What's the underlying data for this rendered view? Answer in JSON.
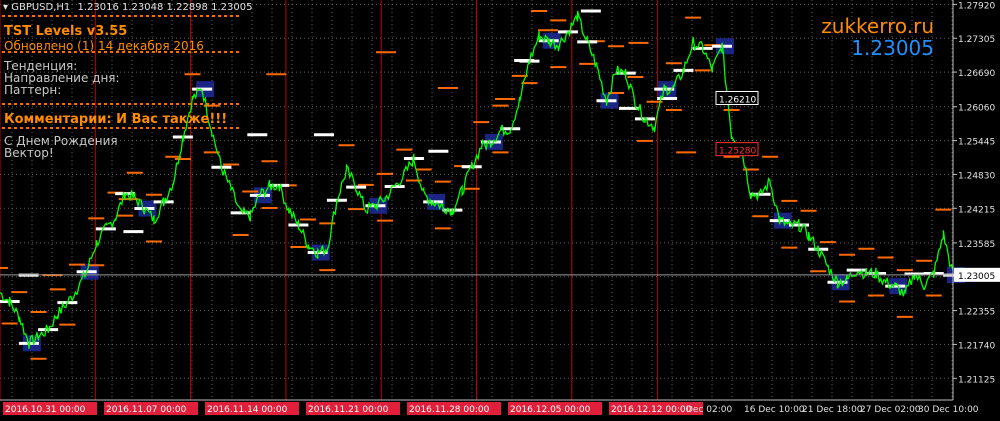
{
  "header": {
    "symbol": "GBPUSD,H1",
    "ohlc": "1.23016 1.23048 1.22898 1.23005"
  },
  "indicator": {
    "title": "TST Levels v3.55",
    "updated": "Обновлено (1)  14 декабря 2016",
    "trend_label": "Тенденция:",
    "direction_label": "Направление дня:",
    "pattern_label": "Паттерн:",
    "comment": "Комментарии: И Вас также!!!",
    "greeting_line1": "С Днем Рождения",
    "greeting_line2": "Вектор!"
  },
  "brand": {
    "site": "zukkerro.ru",
    "price": "1.23005"
  },
  "colors": {
    "background": "#000000",
    "grid": "#7a7a7a",
    "price_line": "#00ff00",
    "resistance": "#ff6a00",
    "level_white": "#ffffff",
    "zone": "#1e2a9a",
    "separator": "#c00000",
    "orange_text": "#ff8c00",
    "blue_text": "#1e90ff",
    "date_box": "#e0203a"
  },
  "chart_data": {
    "type": "line",
    "title": "GBPUSD,H1",
    "ylim": [
      1.2073,
      1.28
    ],
    "y_ticks": [
      "1.27920",
      "1.27305",
      "1.26690",
      "1.26060",
      "1.25445",
      "1.24830",
      "1.24215",
      "1.23585",
      "1.22970",
      "1.22355",
      "1.21740",
      "1.21125"
    ],
    "current_price": "1.23005",
    "x_labels_red": [
      "2016.10.31 00:00",
      "2016.11.07 00:00",
      "2016.11.14 00:00",
      "2016.11.21 00:00",
      "2016.11.28 00:00",
      "2016.12.05 00:00",
      "2016.12.12 00:00"
    ],
    "x_labels_plain": [
      "Dec 02:00",
      "16 Dec 10:00",
      "21 Dec 18:00",
      "27 Dec 02:00",
      "30 Dec 10:00"
    ],
    "level_labels": [
      {
        "text": "1.26210",
        "value": 1.2621,
        "color": "#ffffff"
      },
      {
        "text": "1.25280",
        "value": 1.2528,
        "color": "#ff3030"
      }
    ],
    "series": [
      {
        "values": [
          1.2268,
          1.2252,
          1.2224,
          1.2176,
          1.2188,
          1.2201,
          1.2229,
          1.225,
          1.2274,
          1.2306,
          1.2358,
          1.2384,
          1.2405,
          1.2448,
          1.2441,
          1.2421,
          1.2401,
          1.2433,
          1.247,
          1.2551,
          1.262,
          1.2638,
          1.2563,
          1.2496,
          1.2456,
          1.2413,
          1.2407,
          1.2445,
          1.2462,
          1.2463,
          1.2418,
          1.2391,
          1.2356,
          1.2341,
          1.2349,
          1.2436,
          1.2491,
          1.246,
          1.2419,
          1.2426,
          1.2439,
          1.2461,
          1.2483,
          1.2512,
          1.2447,
          1.2433,
          1.2425,
          1.2418,
          1.2453,
          1.2497,
          1.2533,
          1.2542,
          1.2563,
          1.2566,
          1.2617,
          1.2689,
          1.2735,
          1.2726,
          1.2718,
          1.2742,
          1.277,
          1.2724,
          1.268,
          1.2617,
          1.2671,
          1.2667,
          1.2615,
          1.2584,
          1.257,
          1.2638,
          1.264,
          1.2672,
          1.2723,
          1.2712,
          1.2673,
          1.2716,
          1.2555,
          1.2534,
          1.2447,
          1.2447,
          1.247,
          1.2399,
          1.239,
          1.2391,
          1.2372,
          1.2347,
          1.2315,
          1.2287,
          1.2292,
          1.2309,
          1.2303,
          1.2303,
          1.2287,
          1.228,
          1.2264,
          1.2302,
          1.2281,
          1.2303,
          1.2374,
          1.23
        ]
      }
    ],
    "resistance_levels": [
      {
        "x": 0.055,
        "value": 1.23
      },
      {
        "x": 0.135,
        "value": 1.2438
      },
      {
        "x": 0.29,
        "value": 1.2665
      },
      {
        "x": 0.405,
        "value": 1.2705
      },
      {
        "x": 0.47,
        "value": 1.264
      },
      {
        "x": 0.53,
        "value": 1.262
      },
      {
        "x": 0.575,
        "value": 1.2745
      },
      {
        "x": 0.67,
        "value": 1.2722
      },
      {
        "x": 0.72,
        "value": 1.2523
      }
    ],
    "support_levels": [
      {
        "x": 0.03,
        "value": 1.23
      },
      {
        "x": 0.14,
        "value": 1.2379
      },
      {
        "x": 0.27,
        "value": 1.2555
      },
      {
        "x": 0.34,
        "value": 1.2555
      },
      {
        "x": 0.46,
        "value": 1.2525
      },
      {
        "x": 0.55,
        "value": 1.269
      },
      {
        "x": 0.62,
        "value": 1.278
      },
      {
        "x": 0.66,
        "value": 1.2603
      },
      {
        "x": 0.7,
        "value": 1.2621
      }
    ],
    "separators_frac": [
      0.0,
      0.1,
      0.2,
      0.3,
      0.4,
      0.5,
      0.6,
      0.69
    ]
  }
}
